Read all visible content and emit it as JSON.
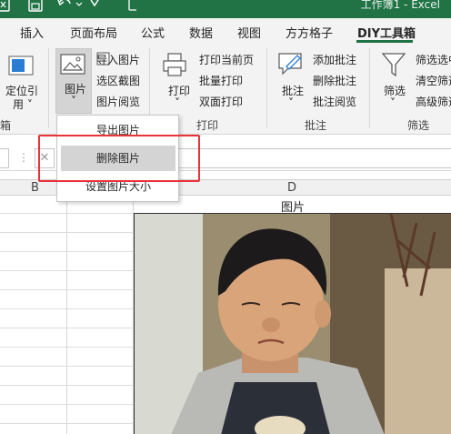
{
  "title_bar": {
    "title": "工作簿1 - Excel",
    "background": "#217346"
  },
  "ribbon_tabs": [
    "插入",
    "页面布局",
    "公式",
    "数据",
    "视图",
    "方方格子",
    "DIY工具箱"
  ],
  "active_tab": "DIY工具箱",
  "accent_color": "#217346",
  "ribbon": {
    "locate": {
      "line1": "定位引",
      "line2": "用 ˅"
    },
    "left_group_label": "箱",
    "picture_button": {
      "label": "图片",
      "caret": "˅"
    },
    "picture_items": [
      "导入图片",
      "选区截图",
      "图片阅览"
    ],
    "print_button": {
      "label": "打印",
      "caret": "˅"
    },
    "print_items": [
      "打印当前页",
      "批量打印",
      "双面打印"
    ],
    "print_group_label": "打印",
    "comment_button": {
      "label": "批注",
      "caret": "˅"
    },
    "comment_items": [
      "添加批注",
      "删除批注",
      "批注阅览"
    ],
    "comment_group_label": "批注",
    "filter_button": {
      "label": "筛选",
      "caret": "˅"
    },
    "filter_items": [
      "筛选选中",
      "清空筛选",
      "高级筛选"
    ],
    "filter_group_label": "筛选"
  },
  "formula_bar": {
    "dots": "⋮",
    "cancel": "✕",
    "value": ""
  },
  "sheet": {
    "columns": [
      "B",
      "D"
    ],
    "cell_d1": "图片"
  },
  "dropdown_menu": {
    "items": [
      "导出图片",
      "删除图片",
      "设置图片大小"
    ],
    "hovered_item": "删除图片",
    "highlight_color": "#e8333a"
  }
}
